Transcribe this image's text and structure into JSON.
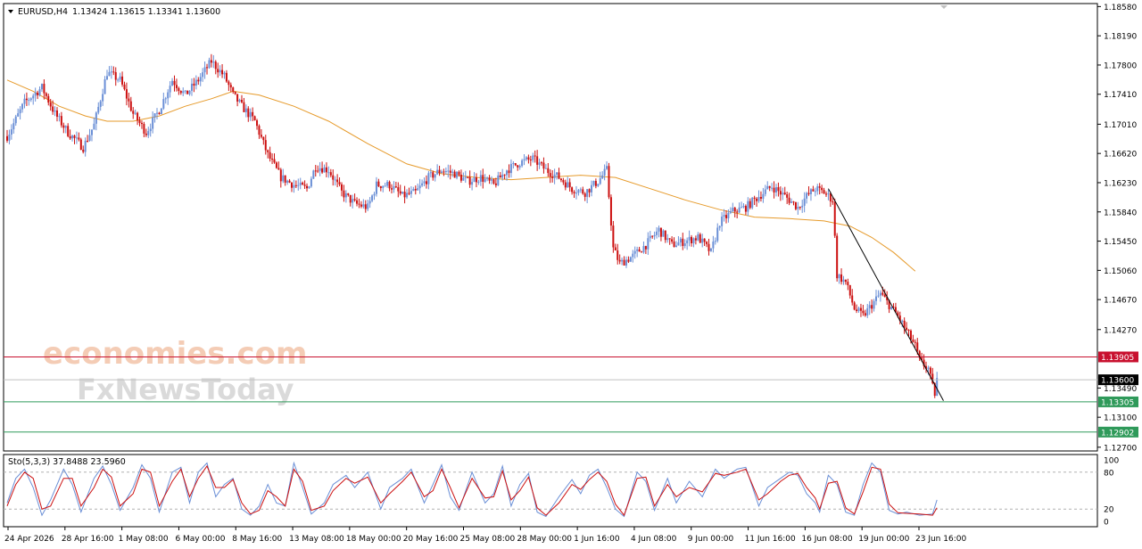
{
  "header": {
    "symbol": "EURUSD,H4",
    "ohlc": "1.13424 1.13615 1.13341 1.13600",
    "stoch_label": "Sto(5,3,3) 37.8488 23.5960"
  },
  "watermark": {
    "line1": "economies.com",
    "line2": "FxNewsToday"
  },
  "colors": {
    "bull": "#6a8fd6",
    "bear": "#cc1010",
    "ma": "#e69a2a",
    "resistance": "#c8102e",
    "support": "#2f9a5a",
    "trendline": "#000000",
    "stoch_main": "#6a8fd6",
    "stoch_signal": "#cc1010"
  },
  "chart_data": [
    {
      "type": "candlestick",
      "title": "EURUSD,H4",
      "y_ticks": [
        "1.18580",
        "1.18190",
        "1.17800",
        "1.17410",
        "1.17010",
        "1.16620",
        "1.16230",
        "1.15840",
        "1.15450",
        "1.15060",
        "1.14670",
        "1.14270",
        "1.13490",
        "1.13100",
        "1.12700"
      ],
      "x_ticks": [
        "24 Apr 2026",
        "28 Apr 16:00",
        "1 May 08:00",
        "6 May 00:00",
        "8 May 16:00",
        "13 May 08:00",
        "18 May 00:00",
        "20 May 16:00",
        "25 May 08:00",
        "28 May 00:00",
        "1 Jun 16:00",
        "4 Jun 08:00",
        "9 Jun 00:00",
        "11 Jun 16:00",
        "16 Jun 08:00",
        "19 Jun 00:00",
        "23 Jun 16:00"
      ],
      "ylim": [
        1.1265,
        1.1862
      ],
      "close_path": [
        [
          0,
          1.1685
        ],
        [
          8,
          1.173
        ],
        [
          16,
          1.175
        ],
        [
          22,
          1.1715
        ],
        [
          28,
          1.169
        ],
        [
          35,
          1.167
        ],
        [
          40,
          1.17
        ],
        [
          46,
          1.177
        ],
        [
          52,
          1.176
        ],
        [
          58,
          1.1715
        ],
        [
          64,
          1.169
        ],
        [
          70,
          1.172
        ],
        [
          76,
          1.176
        ],
        [
          82,
          1.174
        ],
        [
          88,
          1.176
        ],
        [
          94,
          1.1785
        ],
        [
          100,
          1.1765
        ],
        [
          104,
          1.174
        ],
        [
          108,
          1.1725
        ],
        [
          114,
          1.1705
        ],
        [
          120,
          1.166
        ],
        [
          126,
          1.163
        ],
        [
          132,
          1.162
        ],
        [
          138,
          1.1615
        ],
        [
          142,
          1.1645
        ],
        [
          148,
          1.164
        ],
        [
          154,
          1.161
        ],
        [
          160,
          1.1595
        ],
        [
          166,
          1.159
        ],
        [
          170,
          1.162
        ],
        [
          176,
          1.162
        ],
        [
          182,
          1.1605
        ],
        [
          188,
          1.161
        ],
        [
          194,
          1.163
        ],
        [
          200,
          1.164
        ],
        [
          206,
          1.1635
        ],
        [
          212,
          1.1625
        ],
        [
          218,
          1.163
        ],
        [
          224,
          1.162
        ],
        [
          230,
          1.164
        ],
        [
          236,
          1.165
        ],
        [
          242,
          1.1655
        ],
        [
          248,
          1.164
        ],
        [
          254,
          1.163
        ],
        [
          260,
          1.1615
        ],
        [
          266,
          1.161
        ],
        [
          272,
          1.1625
        ],
        [
          276,
          1.164
        ],
        [
          279,
          1.1535
        ],
        [
          282,
          1.1515
        ],
        [
          288,
          1.1525
        ],
        [
          294,
          1.154
        ],
        [
          300,
          1.156
        ],
        [
          306,
          1.154
        ],
        [
          312,
          1.1545
        ],
        [
          318,
          1.155
        ],
        [
          324,
          1.153
        ],
        [
          328,
          1.157
        ],
        [
          334,
          1.1585
        ],
        [
          340,
          1.159
        ],
        [
          346,
          1.1605
        ],
        [
          352,
          1.1618
        ],
        [
          358,
          1.1605
        ],
        [
          364,
          1.159
        ],
        [
          368,
          1.1605
        ],
        [
          372,
          1.1615
        ],
        [
          376,
          1.161
        ],
        [
          380,
          1.16
        ],
        [
          382,
          1.15
        ],
        [
          386,
          1.149
        ],
        [
          390,
          1.1455
        ],
        [
          394,
          1.1445
        ],
        [
          398,
          1.146
        ],
        [
          402,
          1.1475
        ],
        [
          406,
          1.146
        ],
        [
          410,
          1.1445
        ],
        [
          414,
          1.1425
        ],
        [
          418,
          1.1405
        ],
        [
          420,
          1.1385
        ],
        [
          424,
          1.1375
        ],
        [
          426,
          1.135
        ],
        [
          427,
          1.1342
        ],
        [
          428,
          1.136
        ]
      ],
      "ma_path": [
        [
          0,
          1.176
        ],
        [
          12,
          1.1745
        ],
        [
          24,
          1.1725
        ],
        [
          36,
          1.1712
        ],
        [
          46,
          1.1705
        ],
        [
          58,
          1.1705
        ],
        [
          70,
          1.1712
        ],
        [
          82,
          1.1725
        ],
        [
          94,
          1.1735
        ],
        [
          104,
          1.1745
        ],
        [
          116,
          1.174
        ],
        [
          132,
          1.1725
        ],
        [
          148,
          1.1705
        ],
        [
          166,
          1.1675
        ],
        [
          184,
          1.1648
        ],
        [
          200,
          1.1635
        ],
        [
          216,
          1.163
        ],
        [
          232,
          1.1627
        ],
        [
          248,
          1.163
        ],
        [
          264,
          1.1633
        ],
        [
          280,
          1.163
        ],
        [
          296,
          1.1615
        ],
        [
          312,
          1.16
        ],
        [
          328,
          1.1587
        ],
        [
          344,
          1.1577
        ],
        [
          360,
          1.1575
        ],
        [
          376,
          1.1572
        ],
        [
          388,
          1.1565
        ],
        [
          398,
          1.155
        ],
        [
          408,
          1.153
        ],
        [
          418,
          1.1505
        ]
      ],
      "resistance": {
        "value": 1.13905,
        "label": "1.13905"
      },
      "last_price": {
        "value": 1.136,
        "label": "1.13600"
      },
      "support1": {
        "value": 1.13305,
        "label": "1.13305"
      },
      "support2": {
        "value": 1.12902,
        "label": "1.12902"
      },
      "trendline": [
        [
          378,
          1.1615
        ],
        [
          431,
          1.1332
        ]
      ]
    },
    {
      "type": "line",
      "title": "Sto(5,3,3)",
      "ylim": [
        0,
        100
      ],
      "y_ticks": [
        "100",
        "80",
        "20",
        "0"
      ],
      "levels": [
        80,
        20
      ],
      "main_path": [
        [
          0,
          30
        ],
        [
          4,
          70
        ],
        [
          8,
          85
        ],
        [
          12,
          55
        ],
        [
          16,
          10
        ],
        [
          20,
          35
        ],
        [
          26,
          85
        ],
        [
          30,
          60
        ],
        [
          34,
          15
        ],
        [
          40,
          70
        ],
        [
          44,
          90
        ],
        [
          48,
          60
        ],
        [
          52,
          18
        ],
        [
          58,
          55
        ],
        [
          62,
          92
        ],
        [
          66,
          70
        ],
        [
          70,
          15
        ],
        [
          76,
          80
        ],
        [
          80,
          88
        ],
        [
          84,
          30
        ],
        [
          88,
          80
        ],
        [
          92,
          95
        ],
        [
          96,
          40
        ],
        [
          100,
          60
        ],
        [
          104,
          70
        ],
        [
          108,
          20
        ],
        [
          112,
          10
        ],
        [
          116,
          25
        ],
        [
          120,
          60
        ],
        [
          124,
          30
        ],
        [
          128,
          25
        ],
        [
          132,
          95
        ],
        [
          136,
          55
        ],
        [
          140,
          12
        ],
        [
          146,
          30
        ],
        [
          150,
          60
        ],
        [
          156,
          75
        ],
        [
          160,
          55
        ],
        [
          166,
          80
        ],
        [
          172,
          20
        ],
        [
          176,
          55
        ],
        [
          182,
          70
        ],
        [
          186,
          85
        ],
        [
          192,
          30
        ],
        [
          196,
          60
        ],
        [
          200,
          92
        ],
        [
          204,
          40
        ],
        [
          208,
          18
        ],
        [
          214,
          80
        ],
        [
          220,
          30
        ],
        [
          224,
          45
        ],
        [
          228,
          90
        ],
        [
          232,
          25
        ],
        [
          236,
          60
        ],
        [
          240,
          78
        ],
        [
          244,
          15
        ],
        [
          248,
          8
        ],
        [
          254,
          40
        ],
        [
          260,
          68
        ],
        [
          264,
          45
        ],
        [
          268,
          75
        ],
        [
          272,
          85
        ],
        [
          276,
          55
        ],
        [
          280,
          20
        ],
        [
          284,
          8
        ],
        [
          290,
          80
        ],
        [
          294,
          65
        ],
        [
          298,
          18
        ],
        [
          304,
          70
        ],
        [
          308,
          30
        ],
        [
          314,
          65
        ],
        [
          320,
          40
        ],
        [
          326,
          85
        ],
        [
          330,
          70
        ],
        [
          336,
          85
        ],
        [
          340,
          88
        ],
        [
          346,
          25
        ],
        [
          350,
          55
        ],
        [
          356,
          70
        ],
        [
          360,
          80
        ],
        [
          364,
          75
        ],
        [
          368,
          45
        ],
        [
          372,
          30
        ],
        [
          374,
          15
        ],
        [
          378,
          75
        ],
        [
          382,
          60
        ],
        [
          386,
          15
        ],
        [
          390,
          10
        ],
        [
          394,
          60
        ],
        [
          398,
          95
        ],
        [
          402,
          80
        ],
        [
          406,
          18
        ],
        [
          410,
          12
        ],
        [
          414,
          15
        ],
        [
          420,
          10
        ],
        [
          426,
          12
        ],
        [
          428,
          35
        ]
      ],
      "signal_path": [
        [
          0,
          25
        ],
        [
          4,
          60
        ],
        [
          8,
          80
        ],
        [
          12,
          70
        ],
        [
          16,
          20
        ],
        [
          20,
          25
        ],
        [
          26,
          70
        ],
        [
          30,
          70
        ],
        [
          34,
          25
        ],
        [
          40,
          55
        ],
        [
          44,
          85
        ],
        [
          48,
          72
        ],
        [
          52,
          25
        ],
        [
          58,
          45
        ],
        [
          62,
          85
        ],
        [
          66,
          80
        ],
        [
          70,
          25
        ],
        [
          76,
          65
        ],
        [
          80,
          85
        ],
        [
          84,
          40
        ],
        [
          88,
          70
        ],
        [
          92,
          90
        ],
        [
          96,
          55
        ],
        [
          100,
          55
        ],
        [
          104,
          68
        ],
        [
          108,
          30
        ],
        [
          112,
          12
        ],
        [
          116,
          18
        ],
        [
          120,
          50
        ],
        [
          124,
          40
        ],
        [
          128,
          25
        ],
        [
          132,
          85
        ],
        [
          136,
          65
        ],
        [
          140,
          18
        ],
        [
          146,
          25
        ],
        [
          150,
          50
        ],
        [
          156,
          70
        ],
        [
          160,
          62
        ],
        [
          166,
          72
        ],
        [
          172,
          30
        ],
        [
          176,
          45
        ],
        [
          182,
          65
        ],
        [
          186,
          80
        ],
        [
          192,
          40
        ],
        [
          196,
          50
        ],
        [
          200,
          85
        ],
        [
          204,
          55
        ],
        [
          208,
          22
        ],
        [
          214,
          70
        ],
        [
          220,
          38
        ],
        [
          224,
          40
        ],
        [
          228,
          82
        ],
        [
          232,
          35
        ],
        [
          236,
          50
        ],
        [
          240,
          72
        ],
        [
          244,
          22
        ],
        [
          248,
          10
        ],
        [
          254,
          30
        ],
        [
          260,
          60
        ],
        [
          264,
          52
        ],
        [
          268,
          68
        ],
        [
          272,
          80
        ],
        [
          276,
          65
        ],
        [
          280,
          28
        ],
        [
          284,
          10
        ],
        [
          290,
          70
        ],
        [
          294,
          72
        ],
        [
          298,
          25
        ],
        [
          304,
          60
        ],
        [
          308,
          40
        ],
        [
          314,
          55
        ],
        [
          320,
          48
        ],
        [
          326,
          78
        ],
        [
          330,
          75
        ],
        [
          336,
          80
        ],
        [
          340,
          85
        ],
        [
          346,
          35
        ],
        [
          350,
          45
        ],
        [
          356,
          65
        ],
        [
          360,
          75
        ],
        [
          364,
          78
        ],
        [
          368,
          55
        ],
        [
          372,
          38
        ],
        [
          374,
          20
        ],
        [
          378,
          62
        ],
        [
          382,
          65
        ],
        [
          386,
          22
        ],
        [
          390,
          12
        ],
        [
          394,
          48
        ],
        [
          398,
          88
        ],
        [
          402,
          85
        ],
        [
          406,
          28
        ],
        [
          410,
          14
        ],
        [
          414,
          13
        ],
        [
          420,
          12
        ],
        [
          426,
          10
        ],
        [
          428,
          22
        ]
      ]
    }
  ]
}
